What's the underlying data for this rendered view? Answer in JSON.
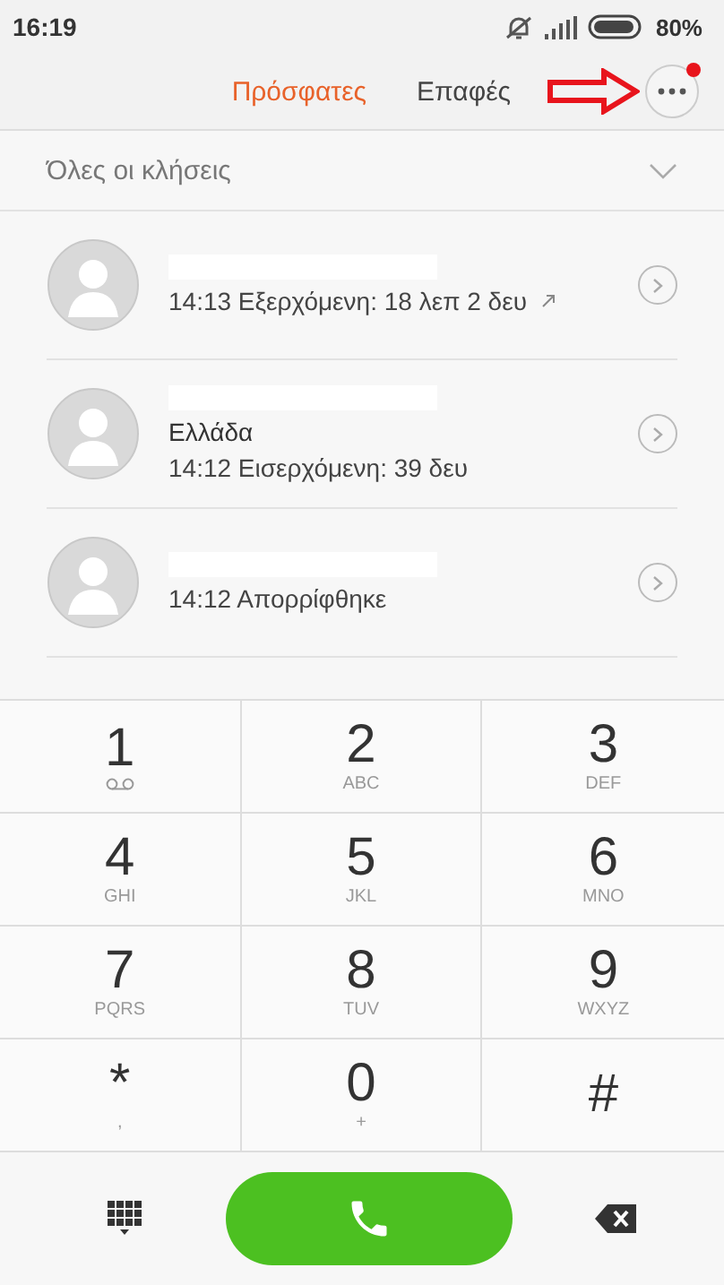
{
  "status_bar": {
    "time": "16:19",
    "battery": "80%"
  },
  "tabs": [
    {
      "label": "Πρόσφατες",
      "selected": true
    },
    {
      "label": "Επαφές",
      "selected": false
    }
  ],
  "more_menu": {
    "notification": true
  },
  "filter": {
    "label": "Όλες οι κλήσεις"
  },
  "calls": [
    {
      "detail": "14:13 Εξερχόμενη: 18 λεπ 2 δευ",
      "outgoing": true
    },
    {
      "location": "Ελλάδα",
      "detail": "14:12 Εισερχόμενη: 39 δευ",
      "outgoing": false
    },
    {
      "detail": "14:12 Απορρίφθηκε",
      "outgoing": false
    }
  ],
  "keys": [
    {
      "digit": "1",
      "kind": "voicemail"
    },
    {
      "digit": "2",
      "kind": "letters",
      "sub": "ABC"
    },
    {
      "digit": "3",
      "kind": "letters",
      "sub": "DEF"
    },
    {
      "digit": "4",
      "kind": "letters",
      "sub": "GHI"
    },
    {
      "digit": "5",
      "kind": "letters",
      "sub": "JKL"
    },
    {
      "digit": "6",
      "kind": "letters",
      "sub": "MNO"
    },
    {
      "digit": "7",
      "kind": "letters",
      "sub": "PQRS"
    },
    {
      "digit": "8",
      "kind": "letters",
      "sub": "TUV"
    },
    {
      "digit": "9",
      "kind": "letters",
      "sub": "WXYZ"
    },
    {
      "digit": "*",
      "kind": "letters",
      "sub": ","
    },
    {
      "digit": "0",
      "kind": "letters",
      "sub": "+"
    },
    {
      "digit": "#",
      "kind": "letters"
    }
  ]
}
